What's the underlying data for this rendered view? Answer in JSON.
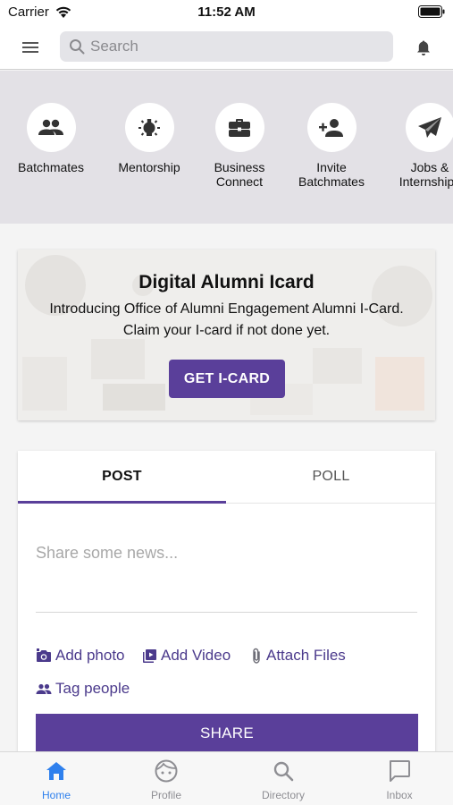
{
  "status_bar": {
    "carrier": "Carrier",
    "time": "11:52 AM"
  },
  "header": {
    "search_placeholder": "Search",
    "search_value": ""
  },
  "quick_actions": [
    {
      "label": "Batchmates",
      "icon": "people-icon"
    },
    {
      "label": "Mentorship",
      "icon": "lightbulb-icon"
    },
    {
      "label": "Business\nConnect",
      "icon": "briefcase-icon"
    },
    {
      "label": "Invite\nBatchmates",
      "icon": "person-add-icon"
    },
    {
      "label": "Jobs &\nInternships",
      "icon": "paper-plane-icon"
    }
  ],
  "icard": {
    "title": "Digital Alumni Icard",
    "description": "Introducing Office of Alumni Engagement Alumni I-Card.\nClaim your I-card if not done yet.",
    "button_label": "GET I-CARD"
  },
  "composer": {
    "tabs": [
      {
        "label": "POST",
        "active": true
      },
      {
        "label": "POLL",
        "active": false
      }
    ],
    "placeholder": "Share some news...",
    "value": "",
    "actions": {
      "add_photo": "Add photo",
      "add_video": "Add Video",
      "attach_files": "Attach Files",
      "tag_people": "Tag people"
    },
    "share_label": "SHARE"
  },
  "bottom_nav": [
    {
      "label": "Home",
      "icon": "home-icon",
      "active": true
    },
    {
      "label": "Profile",
      "icon": "profile-face-icon",
      "active": false
    },
    {
      "label": "Directory",
      "icon": "search-icon",
      "active": false
    },
    {
      "label": "Inbox",
      "icon": "chat-icon",
      "active": false
    }
  ],
  "colors": {
    "accent": "#5a3f9a",
    "nav_active": "#2f80ed",
    "action_text": "#4b3a8c"
  }
}
